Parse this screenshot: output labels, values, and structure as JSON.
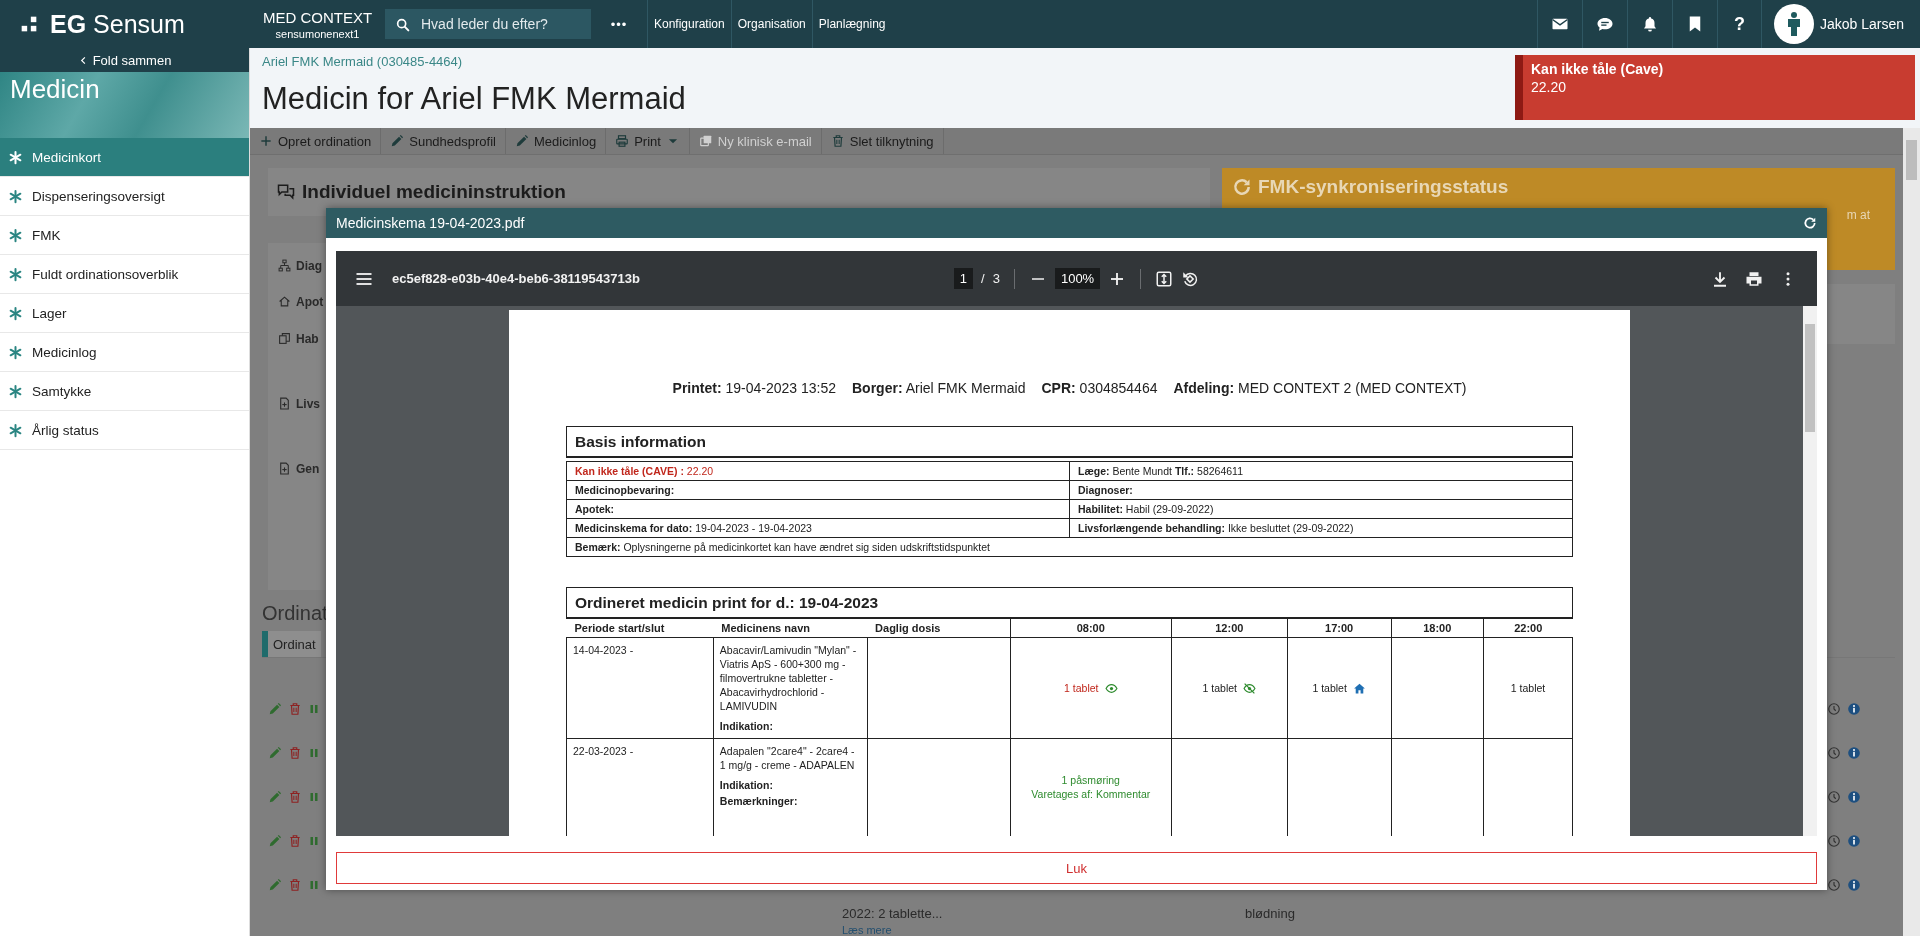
{
  "topbar": {
    "logo": "**EG** Sensum",
    "context": {
      "name": "MED CONTEXT",
      "sub": "sensumonenext1"
    },
    "search": {
      "placeholder": "Hvad leder du efter?"
    },
    "more": "•••",
    "nav": [
      "Konfiguration",
      "Organisation",
      "Planlægning"
    ],
    "help": "?",
    "user": "Jakob Larsen"
  },
  "sidebar": {
    "collapse": "Fold sammen",
    "title": "Medicin",
    "items": [
      {
        "label": "Medicinkort",
        "selected": true
      },
      {
        "label": "Dispenseringsoversigt",
        "selected": false
      },
      {
        "label": "FMK",
        "selected": false
      },
      {
        "label": "Fuldt ordinationsoverblik",
        "selected": false
      },
      {
        "label": "Lager",
        "selected": false
      },
      {
        "label": "Medicinlog",
        "selected": false
      },
      {
        "label": "Samtykke",
        "selected": false
      },
      {
        "label": "Årlig status",
        "selected": false
      }
    ]
  },
  "header": {
    "breadcrumb": "Ariel FMK Mermaid (030485-4464)",
    "title": "Medicin for Ariel FMK Mermaid",
    "alert": {
      "title": "Kan ikke tåle (Cave)",
      "value": "22.20"
    }
  },
  "toolbar": [
    {
      "label": "Opret ordination",
      "kind": "button",
      "disabled": false
    },
    {
      "label": "Sundhedsprofil",
      "kind": "button",
      "disabled": false
    },
    {
      "label": "Medicinlog",
      "kind": "button",
      "disabled": false
    },
    {
      "label": "Print",
      "kind": "split",
      "disabled": false
    },
    {
      "label": "Ny klinisk e-mail",
      "kind": "button",
      "disabled": true
    },
    {
      "label": "Slet tilknytning",
      "kind": "button",
      "disabled": false
    }
  ],
  "background": {
    "instruction_card": "Individuel medicininstruktion",
    "fmk_card": {
      "title": "FMK-synkroniseringsstatus",
      "text": "m at"
    },
    "side_items": [
      "Diag",
      "Apot",
      "Hab",
      "Livs",
      "Gen"
    ],
    "ordination_heading": "Ordinat",
    "ordination_tab": "Ordinat",
    "rows": [
      {},
      {},
      {},
      {},
      {
        "dose": "2022: 2 tablette...",
        "link": "Læs mere",
        "note": "blødning"
      }
    ]
  },
  "modal": {
    "title": "Medicinskema 19-04-2023.pdf",
    "close": "Luk",
    "pdf": {
      "filename": "ec5ef828-e03b-40e4-beb6-38119543713b",
      "page": "1",
      "separator": "/",
      "pages": "3",
      "zoom": "100%",
      "document": {
        "info": [
          "**Printet:** 19-04-2023 13:52",
          "**Borger:** Ariel FMK Mermaid",
          "**CPR:** 0304854464",
          "**Afdeling:** MED CONTEXT 2 (MED CONTEXT)"
        ],
        "basis": {
          "title": "Basis information",
          "rows": [
            [
              {
                "label": "Kan ikke tåle (CAVE) :",
                "value": "22.20",
                "alert": true
              },
              {
                "label": "Læge:",
                "value": "Bente Mundt **Tlf.:** 58264611",
                "alert": false
              }
            ],
            [
              {
                "label": "Medicinopbevaring:",
                "alert": false
              },
              {
                "label": "Diagnoser:",
                "alert": false
              }
            ],
            [
              {
                "label": "Apotek:",
                "alert": false
              },
              {
                "label": "Habilitet:",
                "value": "Habil (29-09-2022)",
                "alert": false
              }
            ],
            [
              {
                "label": "Medicinskema for dato:",
                "value": "19-04-2023 - 19-04-2023",
                "alert": false
              },
              {
                "label": "Livsforlængende behandling:",
                "value": "Ikke besluttet (29-09-2022)",
                "alert": false
              }
            ],
            [
              {
                "label": "Bemærk:",
                "value": "Oplysningerne på medicinkortet kan have ændret sig siden udskriftstidspunktet",
                "alert": false,
                "colspan": 2
              }
            ]
          ]
        },
        "orders": {
          "title": "Ordineret medicin print for d.: 19-04-2023",
          "columns": [
            "Periode start/slut",
            "Medicinens navn",
            "Daglig dosis",
            "08:00",
            "12:00",
            "17:00",
            "18:00",
            "22:00"
          ],
          "rows": [
            {
              "period": "14-04-2023 -",
              "name": "Abacavir/Lamivudin \"Mylan\" - Viatris ApS - 600+300 mg - filmovertrukne tabletter - Abacavirhydrochlorid - LAMIVUDIN",
              "fields": [
                "Indikation:"
              ],
              "times": [
                {
                  "kind": "eye",
                  "text": "1 tablet"
                },
                {
                  "kind": "eye-off",
                  "text": "1 tablet"
                },
                {
                  "kind": "home",
                  "text": "1 tablet"
                },
                {
                  "kind": "empty"
                },
                {
                  "kind": "plain",
                  "text": "1 tablet"
                }
              ]
            },
            {
              "period": "22-03-2023 -",
              "name": "Adapalen \"2care4\" - 2care4 - 1 mg/g - creme - ADAPALEN",
              "fields": [
                "Indikation:",
                "Bemærkninger:"
              ],
              "times": [
                {
                  "kind": "assigned",
                  "text": "1 påsmøring",
                  "note": "Varetages af: Kommentar"
                },
                {
                  "kind": "empty"
                },
                {
                  "kind": "empty"
                },
                {
                  "kind": "empty"
                },
                {
                  "kind": "empty"
                }
              ]
            }
          ]
        }
      }
    }
  }
}
